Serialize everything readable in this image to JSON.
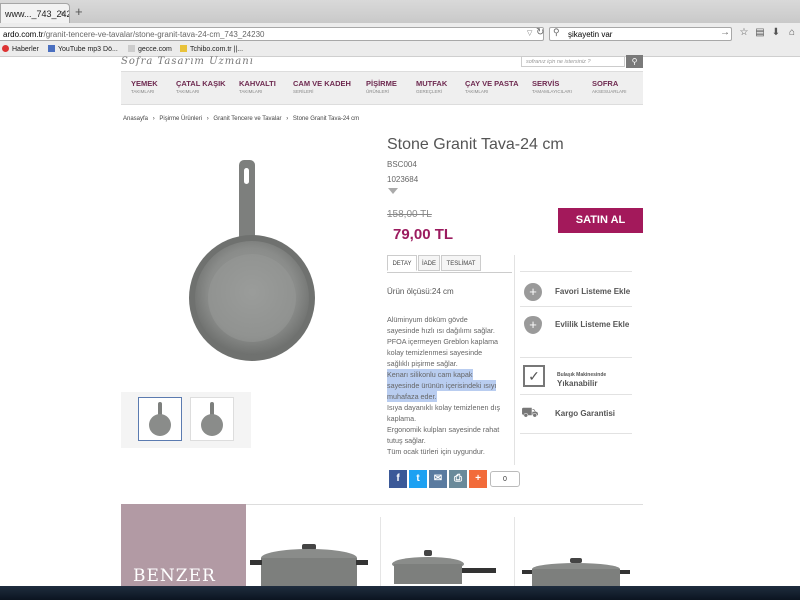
{
  "browser": {
    "tab_title": "www..._743_24230",
    "tab_close": "×",
    "new_tab": "+",
    "url_prefix": "ardo.com.tr",
    "url_path": "/granit-tencere-ve-tavalar/stone-granit-tava-24-cm_743_24230",
    "search_value": "şikayetin var",
    "bookmarks": [
      "Haberler",
      "YouTube mp3 Dö...",
      "gecce.com",
      "Tchibo.com.tr ||..."
    ]
  },
  "site": {
    "brand": "Sofra Tasarım Uzmanı",
    "search_placeholder": "sofranız için ne istersiniz ?",
    "nav": [
      {
        "title": "YEMEK",
        "sub": "TAKIMLARI"
      },
      {
        "title": "ÇATAL KAŞIK",
        "sub": "TAKIMLARI"
      },
      {
        "title": "KAHVALTI",
        "sub": "TAKIMLARI"
      },
      {
        "title": "CAM VE KADEH",
        "sub": "SERİLERİ"
      },
      {
        "title": "PİŞİRME",
        "sub": "ÜRÜNLERİ"
      },
      {
        "title": "MUTFAK",
        "sub": "GEREÇLERİ"
      },
      {
        "title": "ÇAY VE PASTA",
        "sub": "TAKIMLARI"
      },
      {
        "title": "SERVİS",
        "sub": "TAMAMLAYICILARI"
      },
      {
        "title": "SOFRA",
        "sub": "AKSESUARLARI"
      }
    ],
    "breadcrumb": [
      "Anasayfa",
      "›",
      "Pişirme Ürünleri",
      "›",
      "Granit Tencere ve Tavalar",
      "›",
      "Stone Granit Tava-24 cm"
    ]
  },
  "product": {
    "title": "Stone Granit Tava-24 cm",
    "code1": "BSC004",
    "code2": "1023684",
    "old_price": "158,00 TL",
    "price": "79,00 TL",
    "buy_label": "SATIN AL",
    "tabs": [
      "DETAY",
      "İADE",
      "TESLİMAT"
    ],
    "size": "Ürün ölçüsü:24 cm",
    "description": [
      "Alüminyum döküm gövde",
      "sayesinde hızlı ısı dağılımı sağlar.",
      "PFOA içermeyen Greblon kaplama",
      "kolay temizlenmesi sayesinde",
      "sağlıklı pişirme sağlar.",
      "Kenarı silikonlu cam kapak",
      "sayesinde ürünün içerisindeki ısıyı",
      "muhafaza eder.",
      "Isıya dayanıklı kolay temizlenen dış",
      "kaplama.",
      "Ergonomik kulpları sayesinde rahat",
      "tutuş sağlar.",
      "Tüm ocak türleri için uygundur."
    ],
    "features": {
      "favorite": "Favori Listeme Ekle",
      "wedding": "Evlilik Listeme Ekle",
      "dishwasher_small": "Bulaşık Makinesinde",
      "dishwasher_big": "Yıkanabilir",
      "cargo": "Kargo Garantisi"
    },
    "share_count": "0"
  },
  "related": {
    "label": "BENZER"
  },
  "colors": {
    "accent": "#a3195b",
    "price": "#9b1b5f",
    "nav_text": "#6e2a50"
  }
}
